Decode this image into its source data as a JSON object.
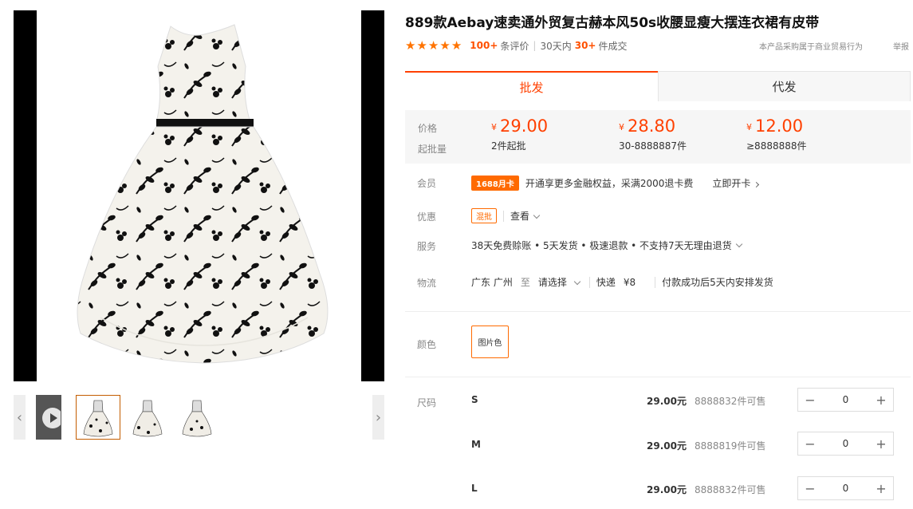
{
  "product": {
    "title": "889款Aebay速卖通外贸复古赫本风50s收腰显瘦大摆连衣裙有皮带",
    "stars": 5,
    "reviews_count": "100+",
    "reviews_label": "条评价",
    "sales_period": "30天内",
    "sales_count": "30+",
    "sales_label": "件成交",
    "procure_note": "本产品采购属于商业贸易行为",
    "report_label": "举报"
  },
  "tabs": [
    "批发",
    "代发"
  ],
  "pricing": {
    "price_label": "价格",
    "moq_label": "起批量",
    "currency": "¥",
    "tiers": [
      {
        "price": "29.00",
        "moq": "2件起批"
      },
      {
        "price": "28.80",
        "moq": "30-8888887件"
      },
      {
        "price": "12.00",
        "moq": "≥8888888件"
      }
    ]
  },
  "member": {
    "label": "会员",
    "badge": "1688月卡",
    "text": "开通享更多金融权益，采满2000退卡费",
    "link": "立即开卡"
  },
  "discount": {
    "label": "优惠",
    "badge": "混批",
    "link": "查看"
  },
  "service": {
    "label": "服务",
    "text": "38天免费赊账 • 5天发货 • 极速退款 • 不支持7天无理由退货"
  },
  "logistics": {
    "label": "物流",
    "origin": "广东 广州",
    "to": "至",
    "destination": "请选择",
    "express": "快递",
    "fee": "¥8",
    "note": "付款成功后5天内安排发货"
  },
  "color": {
    "label": "颜色",
    "options": [
      "图片色"
    ]
  },
  "sizes": {
    "label": "尺码",
    "unit": "元",
    "items": [
      {
        "name": "S",
        "price": "29.00元",
        "stock": "8888832件可售",
        "qty": "0"
      },
      {
        "name": "M",
        "price": "29.00元",
        "stock": "8888819件可售",
        "qty": "0"
      },
      {
        "name": "L",
        "price": "29.00元",
        "stock": "8888832件可售",
        "qty": "0"
      }
    ]
  },
  "colors": {
    "accent": "#ff4000",
    "badge": "#ff6a00",
    "star": "#ff7300"
  }
}
